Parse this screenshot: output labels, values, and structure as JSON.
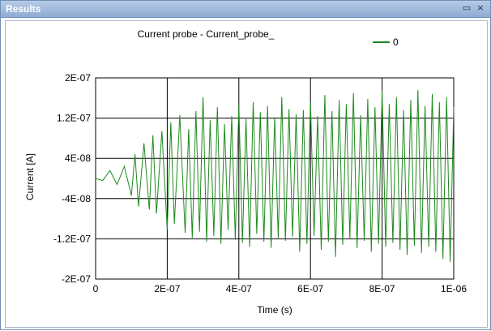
{
  "window": {
    "title": "Results",
    "maximize_icon": "maximize-icon",
    "close_icon": "close-icon",
    "maximize_glyph": "▭",
    "close_glyph": "×"
  },
  "chart_data": {
    "type": "line",
    "title": "Current probe - Current_probe_",
    "xlabel": "Time (s)",
    "ylabel": "Current [A]",
    "xlim": [
      0,
      1e-06
    ],
    "ylim": [
      -2e-07,
      2e-07
    ],
    "xticks": [
      0,
      2e-07,
      4e-07,
      6e-07,
      8e-07,
      1e-06
    ],
    "xtick_labels": [
      "0",
      "2E-07",
      "4E-07",
      "6E-07",
      "8E-07",
      "1E-06"
    ],
    "yticks": [
      2e-07,
      1.2e-07,
      4e-08,
      -4e-08,
      -1.2e-07,
      -2e-07
    ],
    "ytick_labels": [
      "2E-07",
      "1.2E-07",
      "4E-08",
      "-4E-08",
      "-1.2E-07",
      "-2E-07"
    ],
    "grid": true,
    "legend_position": "top-right",
    "series": [
      {
        "name": "0",
        "color": "#1e8a1e",
        "x": [
          0,
          2e-08,
          4e-08,
          6e-08,
          8e-08,
          1e-07,
          1.1e-07,
          1.2e-07,
          1.35e-07,
          1.5e-07,
          1.6e-07,
          1.7e-07,
          1.85e-07,
          2e-07,
          2.1e-07,
          2.2e-07,
          2.35e-07,
          2.5e-07,
          2.6e-07,
          2.7e-07,
          2.8e-07,
          2.9e-07,
          3e-07,
          3.1e-07,
          3.2e-07,
          3.3e-07,
          3.4e-07,
          3.5e-07,
          3.6e-07,
          3.7e-07,
          3.8e-07,
          3.9e-07,
          4e-07,
          4.1e-07,
          4.2e-07,
          4.3e-07,
          4.4e-07,
          4.5e-07,
          4.6e-07,
          4.7e-07,
          4.8e-07,
          4.9e-07,
          5e-07,
          5.1e-07,
          5.2e-07,
          5.3e-07,
          5.4e-07,
          5.5e-07,
          5.6e-07,
          5.7e-07,
          5.8e-07,
          5.9e-07,
          6e-07,
          6.1e-07,
          6.2e-07,
          6.3e-07,
          6.4e-07,
          6.5e-07,
          6.6e-07,
          6.7e-07,
          6.8e-07,
          6.9e-07,
          7e-07,
          7.1e-07,
          7.2e-07,
          7.3e-07,
          7.4e-07,
          7.5e-07,
          7.6e-07,
          7.7e-07,
          7.8e-07,
          7.9e-07,
          8e-07,
          8.1e-07,
          8.2e-07,
          8.3e-07,
          8.4e-07,
          8.5e-07,
          8.6e-07,
          8.7e-07,
          8.8e-07,
          8.9e-07,
          9e-07,
          9.1e-07,
          9.2e-07,
          9.3e-07,
          9.4e-07,
          9.5e-07,
          9.6e-07,
          9.7e-07,
          9.8e-07,
          9.9e-07,
          1e-06
        ],
        "values": [
          0,
          -4e-09,
          1.6e-08,
          -1.2e-08,
          2.4e-08,
          -3.4e-08,
          4.8e-08,
          -5.6e-08,
          7e-08,
          -6.2e-08,
          8.6e-08,
          -7e-08,
          9.4e-08,
          -1.02e-07,
          1.12e-07,
          -9e-08,
          1.26e-07,
          -1.08e-07,
          9.8e-08,
          -1.18e-07,
          1.34e-07,
          -1.06e-07,
          1.62e-07,
          -1.26e-07,
          1.16e-07,
          -1.14e-07,
          1.42e-07,
          -1.3e-07,
          1.08e-07,
          -1.02e-07,
          1.24e-07,
          -1.22e-07,
          1.46e-07,
          -1.28e-07,
          1.18e-07,
          -1.36e-07,
          1.52e-07,
          -1.1e-07,
          1.32e-07,
          -1.26e-07,
          1.44e-07,
          -1.38e-07,
          1.22e-07,
          -1.18e-07,
          1.62e-07,
          -1.24e-07,
          1.38e-07,
          -1.16e-07,
          1.28e-07,
          -1.46e-07,
          1.36e-07,
          -1.3e-07,
          1.52e-07,
          -1.14e-07,
          1.24e-07,
          -1.42e-07,
          1.66e-07,
          -1.26e-07,
          1.34e-07,
          -1.56e-07,
          1.56e-07,
          -1.32e-07,
          1.48e-07,
          -1.2e-07,
          1.7e-07,
          -1.38e-07,
          1.26e-07,
          -1.24e-07,
          1.58e-07,
          -1.46e-07,
          1.42e-07,
          -1.3e-07,
          1.74e-07,
          -1.36e-07,
          1.48e-07,
          -1.28e-07,
          1.62e-07,
          -1.42e-07,
          1.36e-07,
          -1.52e-07,
          1.56e-07,
          -1.34e-07,
          1.76e-07,
          -1.48e-07,
          1.44e-07,
          -1.36e-07,
          1.68e-07,
          -1.46e-07,
          1.52e-07,
          -1.6e-07,
          1.62e-07,
          -1.66e-07,
          1.42e-07
        ]
      }
    ]
  }
}
